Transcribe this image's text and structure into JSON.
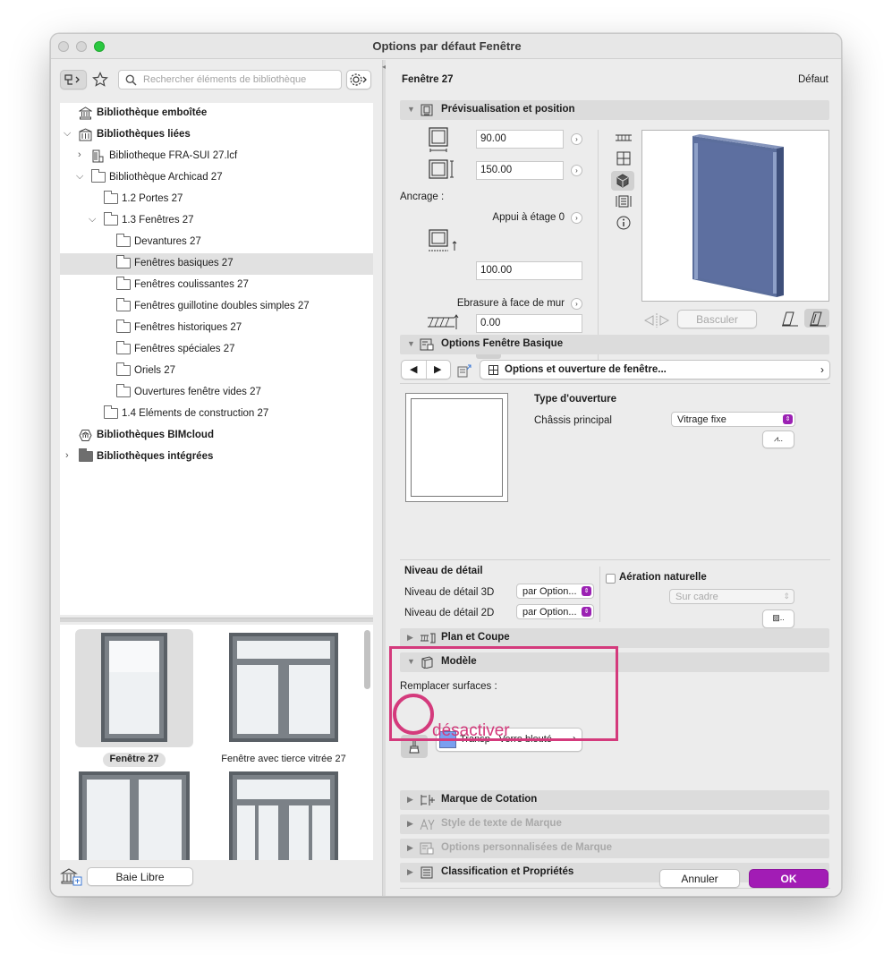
{
  "window": {
    "title": "Options par défaut Fenêtre"
  },
  "library": {
    "search_placeholder": "Rechercher éléments de bibliothèque",
    "tree": [
      {
        "label": "Bibliothèque emboîtée"
      },
      {
        "label": "Bibliothèques liées"
      },
      {
        "label": "Bibliotheque FRA-SUI 27.lcf"
      },
      {
        "label": "Bibliothèque Archicad 27"
      },
      {
        "label": "1.2 Portes 27"
      },
      {
        "label": "1.3 Fenêtres 27"
      },
      {
        "label": "Devantures 27"
      },
      {
        "label": "Fenêtres basiques 27"
      },
      {
        "label": "Fenêtres coulissantes 27"
      },
      {
        "label": "Fenêtres guillotine doubles simples 27"
      },
      {
        "label": "Fenêtres historiques 27"
      },
      {
        "label": "Fenêtres spéciales 27"
      },
      {
        "label": "Oriels 27"
      },
      {
        "label": "Ouvertures fenêtre vides 27"
      },
      {
        "label": "1.4 Eléments de construction 27"
      },
      {
        "label": "Bibliothèques BIMcloud"
      },
      {
        "label": "Bibliothèques intégrées"
      }
    ],
    "thumbnails": [
      {
        "label": "Fenêtre 27"
      },
      {
        "label": "Fenêtre avec tierce vitrée 27"
      }
    ],
    "footer_button": "Baie Libre"
  },
  "header": {
    "element_name": "Fenêtre 27",
    "default_label": "Défaut"
  },
  "preview_section": {
    "title": "Prévisualisation et position",
    "width": "90.00",
    "height": "150.00",
    "anchor_label": "Ancrage :",
    "sill_label": "Appui à étage 0",
    "sill_value": "100.00",
    "reveal_label": "Ebrasure à face de mur",
    "reveal_value": "0.00",
    "flip_button": "Basculer"
  },
  "basic_options": {
    "title": "Options Fenêtre Basique",
    "page_selector": "Options et ouverture de fenêtre...",
    "opening_type_title": "Type d'ouverture",
    "main_frame_label": "Châssis principal",
    "main_frame_value": "Vitrage fixe",
    "detail_title": "Niveau de détail",
    "detail_3d_label": "Niveau de détail 3D",
    "detail_3d_value": "par Option...",
    "detail_2d_label": "Niveau de détail 2D",
    "detail_2d_value": "par Option...",
    "ventilation_label": "Aération naturelle",
    "ventilation_value": "Sur cadre"
  },
  "sections": {
    "plan": "Plan et Coupe",
    "model": "Modèle",
    "dimension": "Marque de Cotation",
    "text_style": "Style de texte de Marque",
    "custom_marker": "Options personnalisées de Marque",
    "classification": "Classification et Propriétés"
  },
  "model": {
    "override_label": "Remplacer surfaces :",
    "surface_name": "Transp - Verre bleuté",
    "surface_color": "#7a9ff0"
  },
  "annotation": {
    "text": "désactiver",
    "color": "#d43a7c"
  },
  "footer": {
    "cancel": "Annuler",
    "ok": "OK"
  }
}
